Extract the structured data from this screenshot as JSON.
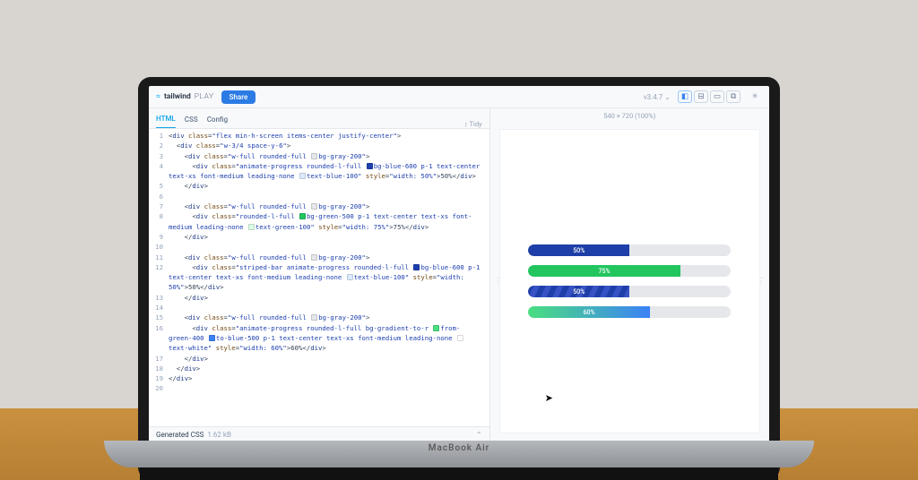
{
  "brand": {
    "name": "tailwind",
    "suffix": "PLAY"
  },
  "share": "Share",
  "version": "v3.4.7",
  "tabs": [
    "HTML",
    "CSS",
    "Config"
  ],
  "tidy": "Tidy",
  "preview_dim": "540 × 720 (100%)",
  "footer": {
    "label": "Generated CSS",
    "size": "1.62 kB"
  },
  "hinge": "MacBook Air",
  "code_lines": [
    {
      "n": "1",
      "html": "&lt;<span class='tag'>div</span> <span class='attr'>class</span>=<span class='str'>\"flex min-h-screen items-center justify-center\"</span>&gt;"
    },
    {
      "n": "2",
      "html": "  &lt;<span class='tag'>div</span> <span class='attr'>class</span>=<span class='str'>\"w-3/4 space-y-6\"</span>&gt;"
    },
    {
      "n": "3",
      "html": "    &lt;<span class='tag'>div</span> <span class='attr'>class</span>=<span class='str'>\"w-full rounded-full <span class='sw' style='background:#e5e7eb'></span>bg-gray-200\"</span>&gt;"
    },
    {
      "n": "4",
      "html": "      &lt;<span class='tag'>div</span> <span class='attr'>class</span>=<span class='str'>\"animate-progress rounded-l-full <span class='sw' style='background:#1e40af'></span>bg-blue-600 p-1 text-center text-xs font-medium leading-none <span class='sw' style='background:#dbeafe'></span>text-blue-100\"</span> <span class='attr'>style</span>=<span class='str'>\"width: 50%\"</span>&gt;50%&lt;/<span class='tag'>div</span>&gt;"
    },
    {
      "n": "5",
      "html": "    &lt;/<span class='tag'>div</span>&gt;"
    },
    {
      "n": "6",
      "html": ""
    },
    {
      "n": "7",
      "html": "    &lt;<span class='tag'>div</span> <span class='attr'>class</span>=<span class='str'>\"w-full rounded-full <span class='sw' style='background:#e5e7eb'></span>bg-gray-200\"</span>&gt;"
    },
    {
      "n": "8",
      "html": "      &lt;<span class='tag'>div</span> <span class='attr'>class</span>=<span class='str'>\"rounded-l-full <span class='sw' style='background:#22c55e'></span>bg-green-500 p-1 text-center text-xs font-medium leading-none <span class='sw' style='background:#dcfce7'></span>text-green-100\"</span> <span class='attr'>style</span>=<span class='str'>\"width: 75%\"</span>&gt;75%&lt;/<span class='tag'>div</span>&gt;"
    },
    {
      "n": "9",
      "html": "    &lt;/<span class='tag'>div</span>&gt;"
    },
    {
      "n": "10",
      "html": ""
    },
    {
      "n": "11",
      "html": "    &lt;<span class='tag'>div</span> <span class='attr'>class</span>=<span class='str'>\"w-full rounded-full <span class='sw' style='background:#e5e7eb'></span>bg-gray-200\"</span>&gt;"
    },
    {
      "n": "12",
      "html": "      &lt;<span class='tag'>div</span> <span class='attr'>class</span>=<span class='str'>\"striped-bar animate-progress rounded-l-full <span class='sw' style='background:#1e40af'></span>bg-blue-600 p-1 text-center text-xs font-medium leading-none <span class='sw' style='background:#dbeafe'></span>text-blue-100\"</span> <span class='attr'>style</span>=<span class='str'>\"width: 50%\"</span>&gt;50%&lt;/<span class='tag'>div</span>&gt;"
    },
    {
      "n": "13",
      "html": "    &lt;/<span class='tag'>div</span>&gt;"
    },
    {
      "n": "14",
      "html": ""
    },
    {
      "n": "15",
      "html": "    &lt;<span class='tag'>div</span> <span class='attr'>class</span>=<span class='str'>\"w-full rounded-full <span class='sw' style='background:#e5e7eb'></span>bg-gray-200\"</span>&gt;"
    },
    {
      "n": "16",
      "html": "      &lt;<span class='tag'>div</span> <span class='attr'>class</span>=<span class='str'>\"animate-progress rounded-l-full bg-gradient-to-r <span class='sw' style='background:#4ade80'></span>from-green-400 <span class='sw' style='background:#3b82f6'></span>to-blue-500 p-1 text-center text-xs font-medium leading-none <span class='sw' style='background:#fff'></span>text-white\"</span> <span class='attr'>style</span>=<span class='str'>\"width: 60%\"</span>&gt;60%&lt;/<span class='tag'>div</span>&gt;"
    },
    {
      "n": "17",
      "html": "    &lt;/<span class='tag'>div</span>&gt;"
    },
    {
      "n": "18",
      "html": "  &lt;/<span class='tag'>div</span>&gt;"
    },
    {
      "n": "19",
      "html": "&lt;/<span class='tag'>div</span>&gt;"
    },
    {
      "n": "20",
      "html": ""
    }
  ],
  "progress": [
    {
      "pct": "50%",
      "cls": "b1"
    },
    {
      "pct": "75%",
      "cls": "b2"
    },
    {
      "pct": "50%",
      "cls": "b3"
    },
    {
      "pct": "60%",
      "cls": "b4"
    }
  ]
}
